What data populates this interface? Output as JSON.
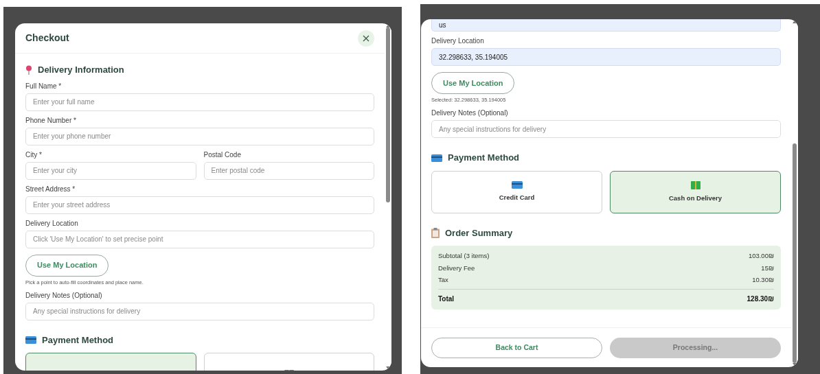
{
  "panels": [
    {
      "header": {
        "title": "Checkout"
      },
      "blocks": [
        {
          "kind": "delivery_section",
          "title": "Delivery Information"
        },
        {
          "kind": "field",
          "label": "Full Name *",
          "placeholder": "Enter your full name"
        },
        {
          "kind": "field",
          "label": "Phone Number *",
          "placeholder": "Enter your phone number"
        },
        {
          "kind": "field_row",
          "fields": [
            {
              "label": "City *",
              "placeholder": "Enter your city"
            },
            {
              "label": "Postal Code",
              "placeholder": "Enter postal code"
            }
          ]
        },
        {
          "kind": "field",
          "label": "Street Address *",
          "placeholder": "Enter your street address"
        },
        {
          "kind": "field",
          "label": "Delivery Location",
          "placeholder": "Click 'Use My Location' to set precise point"
        },
        {
          "kind": "button",
          "label": "Use My Location"
        },
        {
          "kind": "hint",
          "text": "Pick a point to auto-fill coordinates and place name."
        },
        {
          "kind": "field",
          "label": "Delivery Notes (Optional)",
          "placeholder": "Any special instructions for delivery"
        },
        {
          "kind": "payment_section",
          "title": "Payment Method"
        },
        {
          "kind": "payment",
          "options": [
            {
              "selected": true
            },
            {
              "selected": false
            }
          ]
        }
      ]
    },
    {
      "blocks": [
        {
          "kind": "cut_field",
          "value": "us"
        },
        {
          "kind": "field",
          "label": "Delivery Location",
          "value": "32.298633, 35.194005"
        },
        {
          "kind": "button",
          "label": "Use My Location"
        },
        {
          "kind": "hint",
          "text": "Selected: 32.298633, 35.194005"
        },
        {
          "kind": "field",
          "label": "Delivery Notes (Optional)",
          "placeholder": "Any special instructions for delivery"
        },
        {
          "kind": "payment_section",
          "title": "Payment Method"
        },
        {
          "kind": "payment",
          "options": [
            {
              "label": "Credit Card",
              "selected": false
            },
            {
              "label": "Cash on Delivery",
              "selected": true
            }
          ]
        },
        {
          "kind": "summary_section",
          "title": "Order Summary"
        },
        {
          "kind": "summary",
          "rows": [
            {
              "label": "Subtotal (3 items)",
              "amount": "103.00₪"
            },
            {
              "label": "Delivery Fee",
              "amount": "15₪"
            },
            {
              "label": "Tax",
              "amount": "10.30₪"
            }
          ],
          "total": {
            "label": "Total",
            "amount": "128.30₪"
          }
        }
      ],
      "footer": {
        "back": "Back to Cart",
        "submit": {
          "label": "Processing...",
          "disabled": true
        }
      }
    }
  ]
}
